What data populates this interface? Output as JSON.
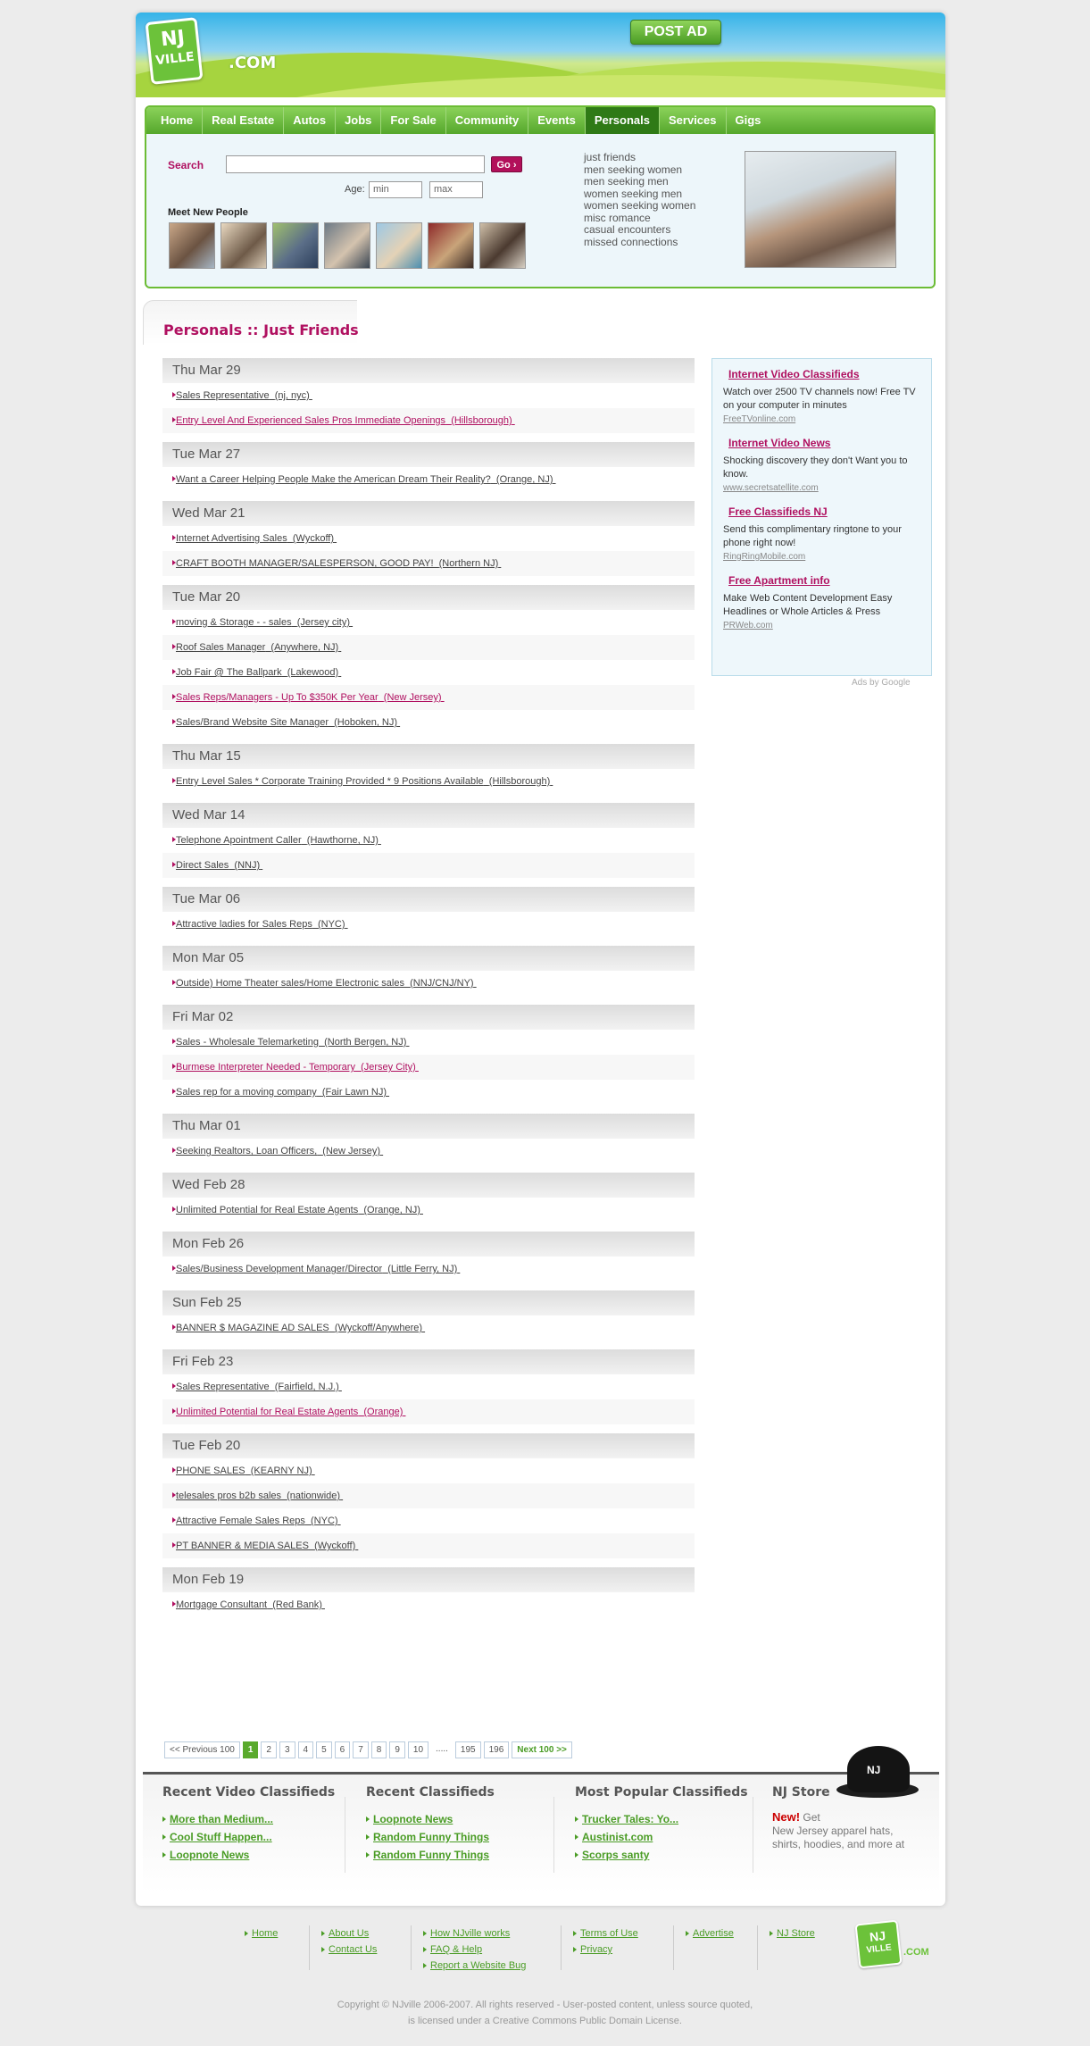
{
  "header": {
    "logo_line1": "NJ",
    "logo_line2": "VILLE",
    "logo_dotcom": ".COM",
    "post_ad": "POST AD"
  },
  "nav": [
    "Home",
    "Real Estate",
    "Autos",
    "Jobs",
    "For Sale",
    "Community",
    "Events",
    "Personals",
    "Services",
    "Gigs"
  ],
  "nav_active": "Personals",
  "search": {
    "label": "Search",
    "go": "Go",
    "age_label": "Age:",
    "min_placeholder": "min",
    "max_placeholder": "max",
    "meet_label": "Meet New People"
  },
  "categories": [
    "just friends",
    "men seeking women",
    "men seeking men",
    "women seeking men",
    "women seeking women",
    "misc romance",
    "casual encounters",
    "missed connections"
  ],
  "page_title": "Personals :: Just Friends",
  "days": [
    {
      "date": "Thu Mar 29",
      "posts": [
        {
          "title": "Sales Representative",
          "loc": "(nj, nyc)",
          "hot": false
        },
        {
          "title": "Entry Level And Experienced Sales Pros Immediate Openings",
          "loc": "(Hillsborough)",
          "hot": true
        }
      ]
    },
    {
      "date": "Tue Mar 27",
      "posts": [
        {
          "title": "Want a Career Helping People Make the American Dream Their Reality?",
          "loc": "(Orange, NJ)",
          "hot": false
        }
      ]
    },
    {
      "date": "Wed Mar 21",
      "posts": [
        {
          "title": "Internet Advertising Sales",
          "loc": "(Wyckoff)",
          "hot": false
        },
        {
          "title": "CRAFT BOOTH MANAGER/SALESPERSON, GOOD PAY!",
          "loc": "(Northern NJ)",
          "hot": false
        }
      ]
    },
    {
      "date": "Tue Mar 20",
      "posts": [
        {
          "title": "moving & Storage - - sales",
          "loc": "(Jersey city)",
          "hot": false
        },
        {
          "title": "Roof Sales Manager",
          "loc": "(Anywhere, NJ)",
          "hot": false
        },
        {
          "title": "Job Fair @ The Ballpark",
          "loc": "(Lakewood)",
          "hot": false
        },
        {
          "title": "Sales Reps/Managers - Up To $350K Per Year",
          "loc": "(New Jersey)",
          "hot": true
        },
        {
          "title": "Sales/Brand Website Site Manager",
          "loc": "(Hoboken, NJ)",
          "hot": false
        }
      ]
    },
    {
      "date": "Thu Mar 15",
      "posts": [
        {
          "title": "Entry Level Sales * Corporate Training Provided * 9 Positions Available",
          "loc": "(Hillsborough)",
          "hot": false
        }
      ]
    },
    {
      "date": "Wed Mar 14",
      "posts": [
        {
          "title": "Telephone Apointment Caller",
          "loc": "(Hawthorne, NJ)",
          "hot": false
        },
        {
          "title": "Direct Sales",
          "loc": "(NNJ)",
          "hot": false
        }
      ]
    },
    {
      "date": "Tue Mar 06",
      "posts": [
        {
          "title": "Attractive ladies for Sales Reps",
          "loc": "(NYC)",
          "hot": false
        }
      ]
    },
    {
      "date": "Mon Mar 05",
      "posts": [
        {
          "title": "Outside) Home Theater sales/Home Electronic sales",
          "loc": "(NNJ/CNJ/NY)",
          "hot": false
        }
      ]
    },
    {
      "date": "Fri Mar 02",
      "posts": [
        {
          "title": "Sales - Wholesale Telemarketing",
          "loc": "(North Bergen, NJ)",
          "hot": false
        },
        {
          "title": "Burmese Interpreter Needed - Temporary",
          "loc": "(Jersey City)",
          "hot": true
        },
        {
          "title": "Sales rep for a moving company",
          "loc": "(Fair Lawn NJ)",
          "hot": false
        }
      ]
    },
    {
      "date": "Thu Mar 01",
      "posts": [
        {
          "title": "Seeking Realtors, Loan Officers,",
          "loc": "(New Jersey)",
          "hot": false
        }
      ]
    },
    {
      "date": "Wed Feb 28",
      "posts": [
        {
          "title": "Unlimited Potential for Real Estate Agents",
          "loc": "(Orange, NJ)",
          "hot": false
        }
      ]
    },
    {
      "date": "Mon Feb 26",
      "posts": [
        {
          "title": "Sales/Business Development Manager/Director",
          "loc": "(Little Ferry, NJ)",
          "hot": false
        }
      ]
    },
    {
      "date": "Sun Feb 25",
      "posts": [
        {
          "title": "BANNER $ MAGAZINE AD SALES",
          "loc": "(Wyckoff/Anywhere)",
          "hot": false
        }
      ]
    },
    {
      "date": "Fri Feb 23",
      "posts": [
        {
          "title": "Sales Representative",
          "loc": "(Fairfield, N.J.)",
          "hot": false
        },
        {
          "title": "Unlimited Potential for Real Estate Agents",
          "loc": "(Orange)",
          "hot": true
        }
      ]
    },
    {
      "date": "Tue Feb 20",
      "posts": [
        {
          "title": "PHONE SALES",
          "loc": "(KEARNY NJ)",
          "hot": false
        },
        {
          "title": "telesales pros b2b sales",
          "loc": "(nationwide)",
          "hot": false
        },
        {
          "title": "Attractive Female Sales Reps",
          "loc": "(NYC)",
          "hot": false
        },
        {
          "title": "PT BANNER & MEDIA SALES",
          "loc": "(Wyckoff)",
          "hot": false
        }
      ]
    },
    {
      "date": "Mon Feb 19",
      "posts": [
        {
          "title": "Mortgage Consultant",
          "loc": "(Red Bank)",
          "hot": false
        }
      ]
    }
  ],
  "pager": {
    "prev": "<< Previous 100",
    "pages": [
      "1",
      "2",
      "3",
      "4",
      "5",
      "6",
      "7",
      "8",
      "9",
      "10"
    ],
    "current": "1",
    "dots": ".....",
    "tail": [
      "195",
      "196"
    ],
    "next": "Next 100 >>"
  },
  "ads": [
    {
      "title": "Internet Video Classifieds",
      "body": "Watch over 2500 TV channels now! Free TV on your computer in minutes",
      "url": "FreeTVonline.com"
    },
    {
      "title": "Internet Video News",
      "body": "Shocking discovery they don't Want you to know.",
      "url": "www.secretsatellite.com"
    },
    {
      "title": "Free Classifieds NJ",
      "body": "Send this complimentary ringtone to your phone right now!",
      "url": "RingRingMobile.com"
    },
    {
      "title": "Free Apartment info",
      "body": "Make Web Content Development Easy Headlines or Whole Articles & Press",
      "url": "PRWeb.com"
    }
  ],
  "ads_by": "Ads by Google",
  "bottom": {
    "recent_video": {
      "title": "Recent Video Classifieds",
      "items": [
        "More than Medium...",
        "Cool Stuff Happen...",
        "Loopnote News"
      ]
    },
    "recent": {
      "title": "Recent Classifieds",
      "items": [
        "Loopnote News",
        "Random Funny Things",
        "Random Funny Things"
      ]
    },
    "popular": {
      "title": "Most Popular Classifieds",
      "items": [
        "Trucker Tales: Yo...",
        "Austinist.com",
        "Scorps santy"
      ]
    },
    "store": {
      "title": "NJ Store",
      "new": "New!",
      "get": "Get",
      "text": "New Jersey apparel hats, shirts, hoodies, and more at",
      "cap_text": "NJ"
    }
  },
  "footer": {
    "col1": [
      "Home"
    ],
    "col2": [
      "About Us",
      "Contact Us"
    ],
    "col3": [
      "How NJville works",
      "FAQ & Help",
      "Report a Website Bug"
    ],
    "col4": [
      "Terms of Use",
      "Privacy"
    ],
    "col5": [
      "Advertise"
    ],
    "col6": [
      "NJ Store"
    ],
    "copyright1": "Copyright © NJville 2006-2007. All rights reserved - User-posted content, unless source quoted,",
    "copyright2": "is licensed under a Creative Commons Public Domain License."
  }
}
